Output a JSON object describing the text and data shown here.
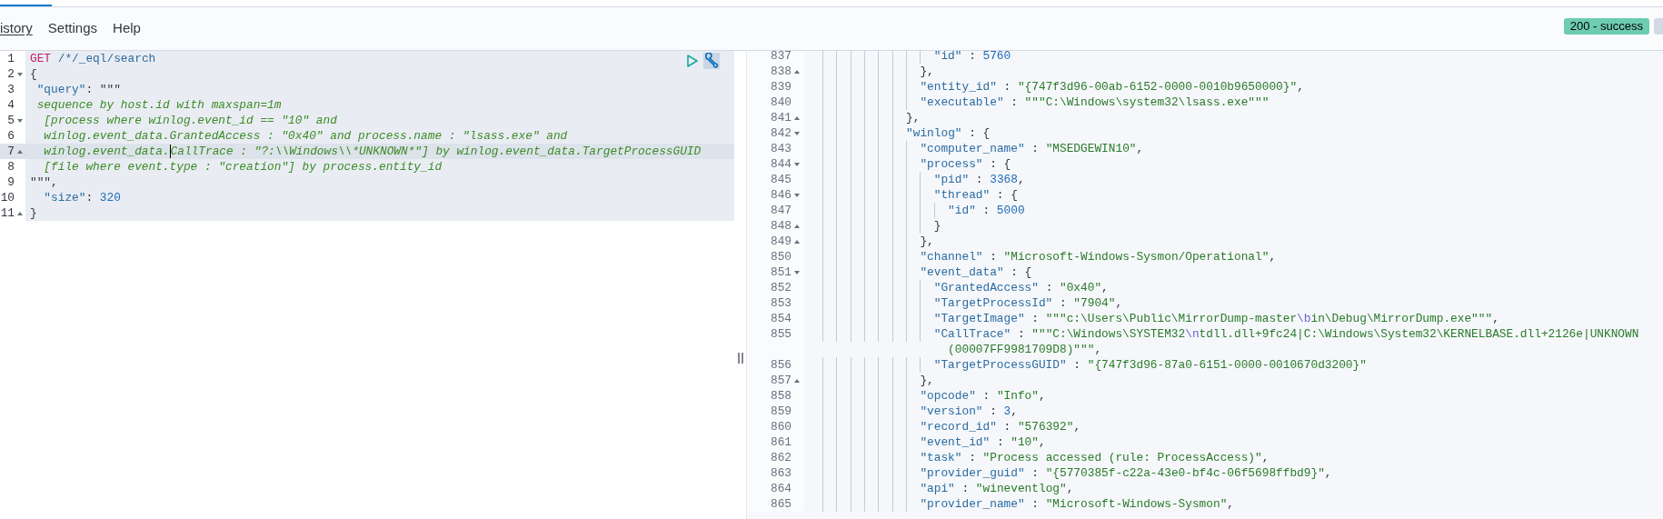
{
  "menu": [
    {
      "label": "istory",
      "selected": true
    },
    {
      "label": "Settings",
      "selected": false
    },
    {
      "label": "Help",
      "selected": false
    }
  ],
  "status_badge": "200 - success",
  "request_editor": {
    "lines": [
      {
        "number": "1",
        "fold_start": false,
        "fold_end": false,
        "active": false,
        "segments": [
          {
            "kind": "method",
            "text": "GET"
          },
          {
            "kind": "url",
            "text": " /*/_eql/search"
          }
        ]
      },
      {
        "number": "2",
        "fold_start": true,
        "fold_end": false,
        "active": false,
        "segments": [
          {
            "kind": "punct",
            "text": "{"
          }
        ]
      },
      {
        "number": "3",
        "fold_start": false,
        "fold_end": false,
        "active": false,
        "segments": [
          {
            "kind": "key",
            "text": " \"query\""
          },
          {
            "kind": "punct",
            "text": ": \"\"\""
          }
        ]
      },
      {
        "number": "4",
        "fold_start": false,
        "fold_end": false,
        "active": false,
        "segments": [
          {
            "kind": "eql",
            "text": " sequence by host.id with maxspan=1m"
          }
        ]
      },
      {
        "number": "5",
        "fold_start": true,
        "fold_end": false,
        "active": false,
        "segments": [
          {
            "kind": "eql",
            "text": "  [process where winlog.event_id == \"10\" and"
          }
        ]
      },
      {
        "number": "6",
        "fold_start": false,
        "fold_end": false,
        "active": false,
        "segments": [
          {
            "kind": "eql",
            "text": "  winlog.event_data.GrantedAccess : \"0x40\" and process.name : \"lsass.exe\" and"
          }
        ]
      },
      {
        "number": "7",
        "fold_start": false,
        "fold_end": true,
        "active": true,
        "segments": [
          {
            "kind": "eql",
            "text": "  winlog.event_data."
          },
          {
            "kind": "cursor"
          },
          {
            "kind": "eql",
            "text": "CallTrace : \"?:\\\\Windows\\\\*UNKNOWN*\"] by winlog.event_data.TargetProcessGUID"
          }
        ]
      },
      {
        "number": "8",
        "fold_start": false,
        "fold_end": false,
        "active": false,
        "segments": [
          {
            "kind": "eql",
            "text": "  [file where event.type : \"creation\"] by process.entity_id"
          }
        ]
      },
      {
        "number": "9",
        "fold_start": false,
        "fold_end": false,
        "active": false,
        "segments": [
          {
            "kind": "punct",
            "text": "\"\"\","
          }
        ]
      },
      {
        "number": "10",
        "fold_start": false,
        "fold_end": false,
        "active": false,
        "segments": [
          {
            "kind": "key",
            "text": "  \"size\""
          },
          {
            "kind": "punct",
            "text": ": "
          },
          {
            "kind": "number",
            "text": "320"
          }
        ]
      },
      {
        "number": "11",
        "fold_start": false,
        "fold_end": true,
        "active": false,
        "segments": [
          {
            "kind": "punct",
            "text": "}"
          }
        ]
      }
    ]
  },
  "response_viewer": {
    "lines": [
      {
        "number": "837",
        "fold_start": false,
        "fold_end": false,
        "segments": [
          {
            "kind": "key",
            "text": "                \"id\""
          },
          {
            "kind": "punct",
            "text": " : "
          },
          {
            "kind": "number",
            "text": "5760"
          }
        ]
      },
      {
        "number": "838",
        "fold_start": false,
        "fold_end": true,
        "segments": [
          {
            "kind": "punct",
            "text": "              },"
          }
        ]
      },
      {
        "number": "839",
        "fold_start": false,
        "fold_end": false,
        "segments": [
          {
            "kind": "key",
            "text": "              \"entity_id\""
          },
          {
            "kind": "punct",
            "text": " : "
          },
          {
            "kind": "string",
            "text": "\"{747f3d96-00ab-6152-0000-0010b9650000}\""
          },
          {
            "kind": "punct",
            "text": ","
          }
        ]
      },
      {
        "number": "840",
        "fold_start": false,
        "fold_end": false,
        "segments": [
          {
            "kind": "key",
            "text": "              \"executable\""
          },
          {
            "kind": "punct",
            "text": " : "
          },
          {
            "kind": "string",
            "text": "\"\"\"C:\\Windows\\system32\\lsass.exe\"\"\""
          }
        ]
      },
      {
        "number": "841",
        "fold_start": false,
        "fold_end": true,
        "segments": [
          {
            "kind": "punct",
            "text": "            },"
          }
        ]
      },
      {
        "number": "842",
        "fold_start": true,
        "fold_end": false,
        "segments": [
          {
            "kind": "key",
            "text": "            \"winlog\""
          },
          {
            "kind": "punct",
            "text": " : {"
          }
        ]
      },
      {
        "number": "843",
        "fold_start": false,
        "fold_end": false,
        "segments": [
          {
            "kind": "key",
            "text": "              \"computer_name\""
          },
          {
            "kind": "punct",
            "text": " : "
          },
          {
            "kind": "string",
            "text": "\"MSEDGEWIN10\""
          },
          {
            "kind": "punct",
            "text": ","
          }
        ]
      },
      {
        "number": "844",
        "fold_start": true,
        "fold_end": false,
        "segments": [
          {
            "kind": "key",
            "text": "              \"process\""
          },
          {
            "kind": "punct",
            "text": " : {"
          }
        ]
      },
      {
        "number": "845",
        "fold_start": false,
        "fold_end": false,
        "segments": [
          {
            "kind": "key",
            "text": "                \"pid\""
          },
          {
            "kind": "punct",
            "text": " : "
          },
          {
            "kind": "number",
            "text": "3368"
          },
          {
            "kind": "punct",
            "text": ","
          }
        ]
      },
      {
        "number": "846",
        "fold_start": true,
        "fold_end": false,
        "segments": [
          {
            "kind": "key",
            "text": "                \"thread\""
          },
          {
            "kind": "punct",
            "text": " : {"
          }
        ]
      },
      {
        "number": "847",
        "fold_start": false,
        "fold_end": false,
        "segments": [
          {
            "kind": "key",
            "text": "                  \"id\""
          },
          {
            "kind": "punct",
            "text": " : "
          },
          {
            "kind": "number",
            "text": "5000"
          }
        ]
      },
      {
        "number": "848",
        "fold_start": false,
        "fold_end": true,
        "segments": [
          {
            "kind": "punct",
            "text": "                }"
          }
        ]
      },
      {
        "number": "849",
        "fold_start": false,
        "fold_end": true,
        "segments": [
          {
            "kind": "punct",
            "text": "              },"
          }
        ]
      },
      {
        "number": "850",
        "fold_start": false,
        "fold_end": false,
        "segments": [
          {
            "kind": "key",
            "text": "              \"channel\""
          },
          {
            "kind": "punct",
            "text": " : "
          },
          {
            "kind": "string",
            "text": "\"Microsoft-Windows-Sysmon/Operational\""
          },
          {
            "kind": "punct",
            "text": ","
          }
        ]
      },
      {
        "number": "851",
        "fold_start": true,
        "fold_end": false,
        "segments": [
          {
            "kind": "key",
            "text": "              \"event_data\""
          },
          {
            "kind": "punct",
            "text": " : {"
          }
        ]
      },
      {
        "number": "852",
        "fold_start": false,
        "fold_end": false,
        "segments": [
          {
            "kind": "key",
            "text": "                \"GrantedAccess\""
          },
          {
            "kind": "punct",
            "text": " : "
          },
          {
            "kind": "string",
            "text": "\"0x40\""
          },
          {
            "kind": "punct",
            "text": ","
          }
        ]
      },
      {
        "number": "853",
        "fold_start": false,
        "fold_end": false,
        "segments": [
          {
            "kind": "key",
            "text": "                \"TargetProcessId\""
          },
          {
            "kind": "punct",
            "text": " : "
          },
          {
            "kind": "string",
            "text": "\"7904\""
          },
          {
            "kind": "punct",
            "text": ","
          }
        ]
      },
      {
        "number": "854",
        "fold_start": false,
        "fold_end": false,
        "segments": [
          {
            "kind": "key",
            "text": "                \"TargetImage\""
          },
          {
            "kind": "punct",
            "text": " : "
          },
          {
            "kind": "string",
            "text": "\"\"\"c:\\Users\\Public\\MirrorDump-master"
          },
          {
            "kind": "escape",
            "text": "\\b"
          },
          {
            "kind": "string",
            "text": "in\\Debug\\MirrorDump.exe\"\"\""
          },
          {
            "kind": "punct",
            "text": ","
          }
        ]
      },
      {
        "number": "855",
        "fold_start": false,
        "fold_end": false,
        "segments": [
          {
            "kind": "key",
            "text": "                \"CallTrace\""
          },
          {
            "kind": "punct",
            "text": " : "
          },
          {
            "kind": "string",
            "text": "\"\"\"C:\\Windows\\SYSTEM32"
          },
          {
            "kind": "escape",
            "text": "\\n"
          },
          {
            "kind": "string",
            "text": "tdll.dll+9fc24|C:\\Windows\\System32\\KERNELBASE.dll+2126e|UNKNOWN"
          }
        ],
        "wrapped": [
          {
            "kind": "string",
            "text": "                  (00007FF9981709D8)\"\"\""
          },
          {
            "kind": "punct",
            "text": ","
          }
        ]
      },
      {
        "number": "856",
        "fold_start": false,
        "fold_end": false,
        "segments": [
          {
            "kind": "key",
            "text": "                \"TargetProcessGUID\""
          },
          {
            "kind": "punct",
            "text": " : "
          },
          {
            "kind": "string",
            "text": "\"{747f3d96-87a0-6151-0000-0010670d3200}\""
          }
        ]
      },
      {
        "number": "857",
        "fold_start": false,
        "fold_end": true,
        "segments": [
          {
            "kind": "punct",
            "text": "              },"
          }
        ]
      },
      {
        "number": "858",
        "fold_start": false,
        "fold_end": false,
        "segments": [
          {
            "kind": "key",
            "text": "              \"opcode\""
          },
          {
            "kind": "punct",
            "text": " : "
          },
          {
            "kind": "string",
            "text": "\"Info\""
          },
          {
            "kind": "punct",
            "text": ","
          }
        ]
      },
      {
        "number": "859",
        "fold_start": false,
        "fold_end": false,
        "segments": [
          {
            "kind": "key",
            "text": "              \"version\""
          },
          {
            "kind": "punct",
            "text": " : "
          },
          {
            "kind": "number",
            "text": "3"
          },
          {
            "kind": "punct",
            "text": ","
          }
        ]
      },
      {
        "number": "860",
        "fold_start": false,
        "fold_end": false,
        "segments": [
          {
            "kind": "key",
            "text": "              \"record_id\""
          },
          {
            "kind": "punct",
            "text": " : "
          },
          {
            "kind": "string",
            "text": "\"576392\""
          },
          {
            "kind": "punct",
            "text": ","
          }
        ]
      },
      {
        "number": "861",
        "fold_start": false,
        "fold_end": false,
        "segments": [
          {
            "kind": "key",
            "text": "              \"event_id\""
          },
          {
            "kind": "punct",
            "text": " : "
          },
          {
            "kind": "string",
            "text": "\"10\""
          },
          {
            "kind": "punct",
            "text": ","
          }
        ]
      },
      {
        "number": "862",
        "fold_start": false,
        "fold_end": false,
        "segments": [
          {
            "kind": "key",
            "text": "              \"task\""
          },
          {
            "kind": "punct",
            "text": " : "
          },
          {
            "kind": "string",
            "text": "\"Process accessed (rule: ProcessAccess)\""
          },
          {
            "kind": "punct",
            "text": ","
          }
        ]
      },
      {
        "number": "863",
        "fold_start": false,
        "fold_end": false,
        "segments": [
          {
            "kind": "key",
            "text": "              \"provider_guid\""
          },
          {
            "kind": "punct",
            "text": " : "
          },
          {
            "kind": "string",
            "text": "\"{5770385f-c22a-43e0-bf4c-06f5698ffbd9}\""
          },
          {
            "kind": "punct",
            "text": ","
          }
        ]
      },
      {
        "number": "864",
        "fold_start": false,
        "fold_end": false,
        "segments": [
          {
            "kind": "key",
            "text": "              \"api\""
          },
          {
            "kind": "punct",
            "text": " : "
          },
          {
            "kind": "string",
            "text": "\"wineventlog\""
          },
          {
            "kind": "punct",
            "text": ","
          }
        ]
      },
      {
        "number": "865",
        "fold_start": false,
        "fold_end": false,
        "segments": [
          {
            "kind": "key",
            "text": "              \"provider_name\""
          },
          {
            "kind": "punct",
            "text": " : "
          },
          {
            "kind": "string",
            "text": "\"Microsoft-Windows-Sysmon\""
          },
          {
            "kind": "punct",
            "text": ","
          }
        ]
      }
    ]
  }
}
